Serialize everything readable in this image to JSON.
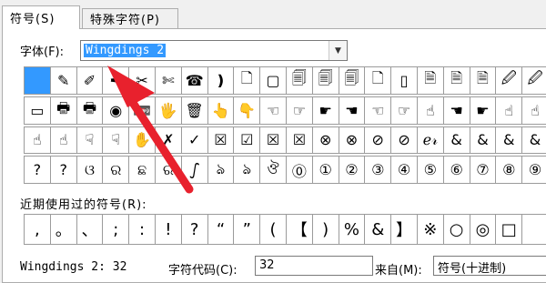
{
  "tabs": [
    {
      "label": "符号(S)",
      "active": true
    },
    {
      "label": "特殊字符(P)",
      "active": false
    }
  ],
  "font": {
    "label": "字体(F):",
    "value": "Wingdings 2"
  },
  "symbols": [
    "",
    "✎",
    "✐",
    "✒",
    "✂",
    "✄",
    "☎",
    "❫",
    "🗋",
    "▢",
    "🗐",
    "🗐",
    "🗐",
    "🗋",
    "▯",
    "🗎",
    "🗎",
    "🗎",
    "🖉",
    "🖉",
    "▭",
    "🖶",
    "🖶",
    "◉",
    "📼",
    "🖐",
    "🗑",
    "👆",
    "👇",
    "☜",
    "☞",
    "☛",
    "☚",
    "☜",
    "☞",
    "☝",
    "☚",
    "☛",
    "☝",
    "☝",
    "☝",
    "☝",
    "☟",
    "☟",
    "✋",
    "✗",
    "✓",
    "☒",
    "☑",
    "☒",
    "☒",
    "⊗",
    "⊗",
    "⊘",
    "⊘",
    "ℯ𝓇",
    "&",
    "&",
    "&",
    "&",
    "?",
    "?",
    "ଓ",
    "ର",
    "ଛ",
    "ର",
    "ഽ",
    "ঌ",
    "ঌ",
    "ঔ",
    "⓪",
    "①",
    "②",
    "③",
    "④",
    "⑤",
    "⑥",
    "⑦",
    "⑧",
    "⑨"
  ],
  "recent": {
    "label": "近期使用过的符号(R):",
    "items": [
      ",",
      "。",
      "、",
      ";",
      ":",
      "!",
      "?",
      "“",
      "”",
      "(",
      "【",
      ")",
      "%",
      "&",
      "】",
      "※",
      "○",
      "◎",
      "□",
      ""
    ]
  },
  "status": {
    "char_name": "Wingdings 2: 32",
    "code_label": "字符代码(C):",
    "code_value": "32",
    "from_label": "来自(M):",
    "from_value": "符号(十进制)"
  },
  "colors": {
    "selection": "#3399ff",
    "annotation_arrow": "#e8212d"
  }
}
